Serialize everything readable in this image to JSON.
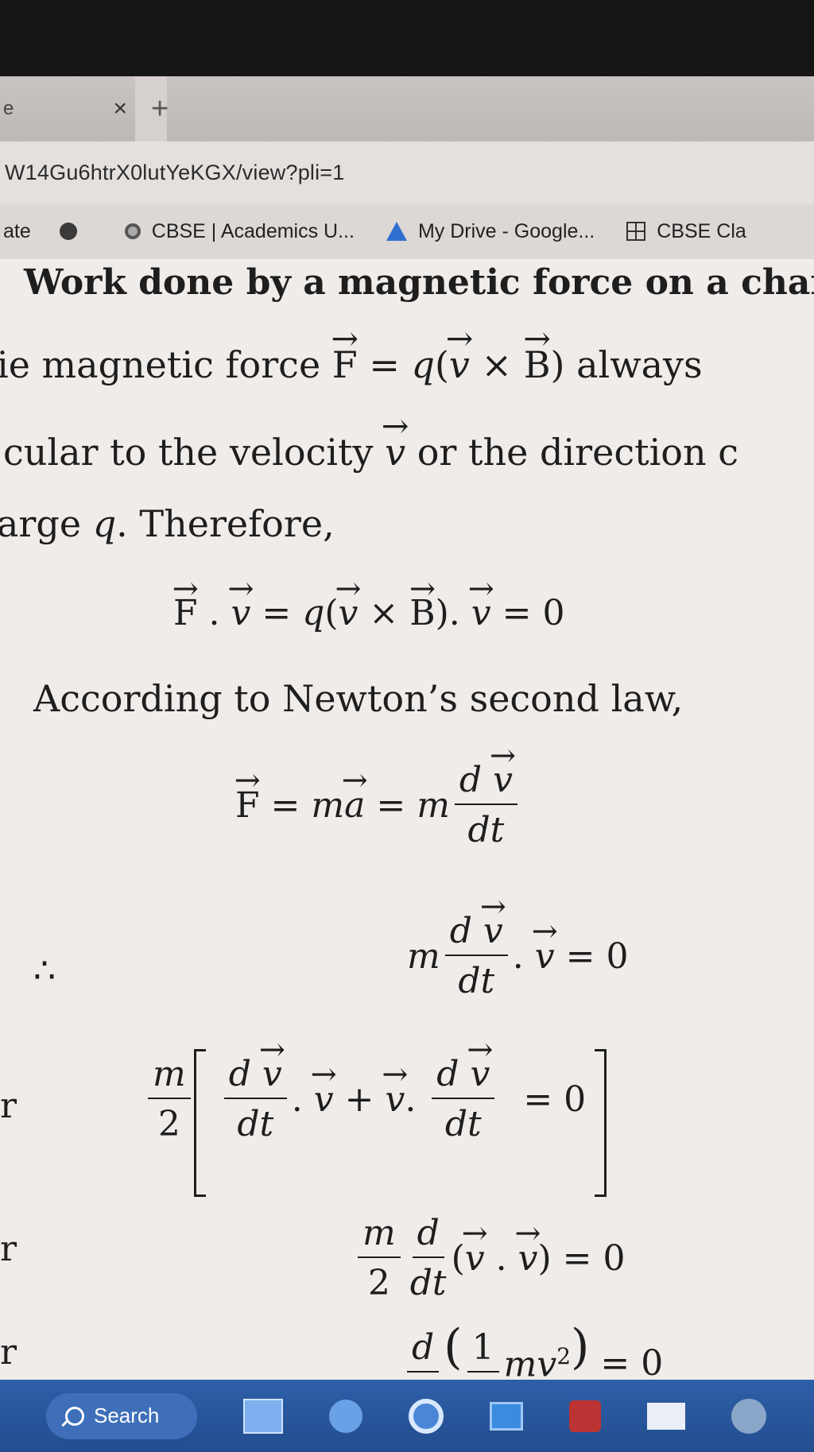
{
  "browser": {
    "tab": {
      "partial_title": "e",
      "close_glyph": "×"
    },
    "new_tab_glyph": "+",
    "url": "W14Gu6htrX0lutYeKGX/view?pli=1",
    "bookmarks": [
      {
        "label": "ate",
        "icon": "none"
      },
      {
        "label": "",
        "icon": "globe-icon"
      },
      {
        "label": "CBSE | Academics U...",
        "icon": "site-icon"
      },
      {
        "label": "My Drive - Google...",
        "icon": "google-drive-icon"
      },
      {
        "label": "CBSE Cla",
        "icon": "grid-icon"
      }
    ]
  },
  "document": {
    "heading": "Work done by a magnetic force on a char",
    "line1": {
      "pre": "ie magnetic force ",
      "F": "F",
      "eq": " = ",
      "q": "q",
      "op": "(",
      "v": "v",
      "x": " × ",
      "B": "B",
      "cl": ")",
      "post": " always"
    },
    "line2": {
      "pre": "cular to the velocity ",
      "v": "v",
      "post": " or the direction c"
    },
    "line3": {
      "pre": "arge ",
      "q": "q",
      "post": ". Therefore,"
    },
    "eq1": {
      "F": "F",
      "dot1": " . ",
      "v1": "v",
      "eq": " = ",
      "q": "q",
      "op": "(",
      "v2": "v",
      "x": " × ",
      "B": "B",
      "cl": ")",
      "dot2": ". ",
      "v3": "v",
      "end": " = 0"
    },
    "line4": "According to Newton’s second law,",
    "eq2": {
      "F": "F",
      "eq1": " = ",
      "m": "m",
      "a": "a",
      "eq2": " = ",
      "m2": "m",
      "num_d": "d",
      "num_v": "v",
      "den": "dt"
    },
    "therefore": "∴",
    "eq3": {
      "m": "m",
      "num_d": "d",
      "num_v": "v",
      "den": "dt",
      "dot": ". ",
      "v": "v",
      "end": " = 0"
    },
    "or1": "r",
    "eq4": {
      "m": "m",
      "two": "2",
      "d1": "d",
      "v1": "v",
      "dt1": "dt",
      "dot1": ". ",
      "va": "v",
      "plus": " + ",
      "vb": "v",
      "dot2": ". ",
      "d2": "d",
      "v2": "v",
      "dt2": "dt",
      "end": "= 0"
    },
    "or2": "r",
    "eq5": {
      "m": "m",
      "two": "2",
      "d": "d",
      "dt": "dt",
      "op": "(",
      "v1": "v",
      "dot": " . ",
      "v2": "v",
      "cl": ")",
      "end": " = 0"
    },
    "or3": "r",
    "eq6": {
      "d": "d",
      "one": "1",
      "mv": "mv",
      "sup": "2",
      "end": " = 0"
    }
  },
  "taskbar": {
    "search_label": "Search"
  }
}
